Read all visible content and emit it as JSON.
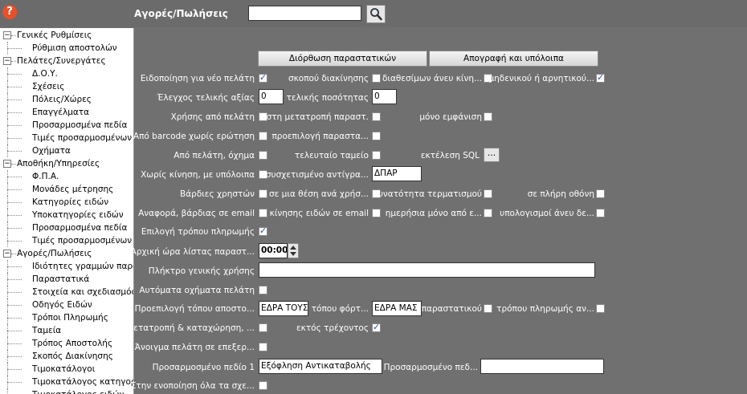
{
  "header": {
    "help_icon": "question-icon",
    "title": "Αγορές/Πωλήσεις",
    "search_value": "",
    "search_icon": "magnifier-icon"
  },
  "sidebar": {
    "items": [
      {
        "label": "Γενικές Ρυθμίσεις",
        "level": 0,
        "expanded": true
      },
      {
        "label": "Ρύθμιση αποστολών",
        "level": 1
      },
      {
        "label": "Πελάτες/Συνεργάτες",
        "level": 0,
        "expanded": true
      },
      {
        "label": "Δ.Ο.Υ.",
        "level": 1
      },
      {
        "label": "Σχέσεις",
        "level": 1
      },
      {
        "label": "Πόλεις/Χώρες",
        "level": 1
      },
      {
        "label": "Επαγγέλματα",
        "level": 1
      },
      {
        "label": "Προσαρμοσμένα πεδία",
        "level": 1
      },
      {
        "label": "Τιμές προσαρμοσμένων π",
        "level": 1
      },
      {
        "label": "Οχήματα",
        "level": 1
      },
      {
        "label": "Αποθήκη/Υπηρεσίες",
        "level": 0,
        "expanded": true
      },
      {
        "label": "Φ.Π.Α.",
        "level": 1
      },
      {
        "label": "Μονάδες μέτρησης",
        "level": 1
      },
      {
        "label": "Κατηγορίες ειδών",
        "level": 1
      },
      {
        "label": "Υποκατηγορίες ειδών",
        "level": 1
      },
      {
        "label": "Προσαρμοσμένα πεδία",
        "level": 1
      },
      {
        "label": "Τιμές προσαρμοσμένων π",
        "level": 1
      },
      {
        "label": "Αγορές/Πωλήσεις",
        "level": 0,
        "expanded": true
      },
      {
        "label": "Ιδιότητες γραμμών παρασ",
        "level": 1
      },
      {
        "label": "Παραστατικά",
        "level": 1
      },
      {
        "label": "Στοιχεία και σχεδιασμός π",
        "level": 1
      },
      {
        "label": "Οδηγός Ειδών",
        "level": 1
      },
      {
        "label": "Τρόποι Πληρωμής",
        "level": 1
      },
      {
        "label": "Ταμεία",
        "level": 1
      },
      {
        "label": "Τρόπος Αποστολής",
        "level": 1
      },
      {
        "label": "Σκοπός Διακίνησης",
        "level": 1
      },
      {
        "label": "Τιμοκατάλογοι",
        "level": 1
      },
      {
        "label": "Τιμοκατάλογος κατηγοριώ",
        "level": 1
      },
      {
        "label": "Τιμοκατάλογος ειδών",
        "level": 1
      }
    ]
  },
  "buttons": {
    "fix_docs": "Διόρθωση παραστατικών",
    "inventory": "Απογραφή και υπόλοιπα",
    "sql_exec": "..."
  },
  "form": {
    "notify_new_customer": "Ειδοποίηση για νέο πελάτη",
    "purpose_movement": "σκοπού διακίνησης",
    "available_no_move": "διαθεσίμων άνευ κίνη...",
    "zero_or_negative": "μηδενικού ή αρνητικού...",
    "check_final_value": "Έλεγχος τελικής αξίας",
    "final_value": "0",
    "final_quantity_label": "τελικής ποσότητας",
    "final_quantity": "0",
    "use_from_customer": "Χρήσης από πελάτη",
    "in_doc_conversion": "στη μετατροπή παραστ.",
    "display_only": "μόνο εμφάνιση",
    "barcode_no_question": "Από barcode χωρίς ερώτηση",
    "default_doc": "προεπιλογή παραστα...",
    "from_customer_vehicle": "Από πελάτη, όχημα",
    "last_cashbox": "τελευταίο ταμείο",
    "exec_sql": "εκτέλεση SQL",
    "no_move_with_balance": "Χωρίς κίνηση, με υπόλοιπα",
    "related_copy": "συσχετισμένο αντίγρα...",
    "related_copy_value": "ΔΠΑΡ",
    "user_shifts": "Βάρδιες χρηστών",
    "one_position_per_user": "σε μια θέση ανά χρήσ...",
    "terminate_option": "δυνατότητα τερματισμού",
    "fullscreen": "σε πλήρη οθόνη",
    "report_shift_email": "Αναφορά, βάρδιας σε email",
    "item_move_email": "κίνησης ειδών σε email",
    "daily_only_from": "ημερήσια μόνο από ε...",
    "calcs_without": "υπολογισμοί άνευ δε...",
    "payment_method_choice": "Επιλογή τρόπου πληρωμής",
    "list_start_time": "Αρχική ώρα λίστας παραστ...",
    "list_start_time_value": "00:00",
    "general_use_key": "Πλήκτρο γενικής χρήσης",
    "general_use_key_value": "",
    "auto_customer_vehicles": "Αυτόματα οχήματα πελάτη",
    "default_ship_place": "Προεπιλογή τόπου αποστο...",
    "ship_place_value": "ΕΔΡΑ ΤΟΥΣ",
    "load_place": "τόπου φόρτ...",
    "load_place_value": "ΕΔΡΑ ΜΑΣ",
    "of_document": "παραστατικού",
    "payment_method_of": "τρόπου πληρωμής αν...",
    "convert_and_register": "Μετατροπή & καταχώρηση, ...",
    "except_current": "εκτός τρέχοντος",
    "open_customer_edit": "Άνοιγμα πελάτη σε επεξερ...",
    "custom_field_1": "Προσαρμοσμένο πεδίο 1",
    "custom_field_1_value": "Εξόφληση Αντικαταβολής",
    "custom_field_2": "Προσαρμοσμένο πεδ...",
    "custom_field_2_value": "",
    "in_notification_all": "Στην ενοποίηση όλα τα σχε..."
  },
  "checkboxes": {
    "notify_new_customer": true,
    "purpose_movement": false,
    "available_no_move": false,
    "zero_or_negative": true,
    "use_from_customer": false,
    "in_doc_conversion": false,
    "display_only": false,
    "barcode_no_question": false,
    "default_doc": false,
    "from_customer_vehicle": false,
    "last_cashbox": false,
    "no_move_with_balance": false,
    "user_shifts": false,
    "one_position_per_user": false,
    "terminate_option": false,
    "fullscreen": false,
    "report_shift_email": false,
    "item_move_email": false,
    "daily_only_from": false,
    "calcs_without": false,
    "payment_method_choice": true,
    "auto_customer_vehicles": false,
    "of_document": false,
    "payment_method_of": false,
    "convert_and_register": false,
    "except_current": true,
    "open_customer_edit": false,
    "in_notification_all": false
  }
}
